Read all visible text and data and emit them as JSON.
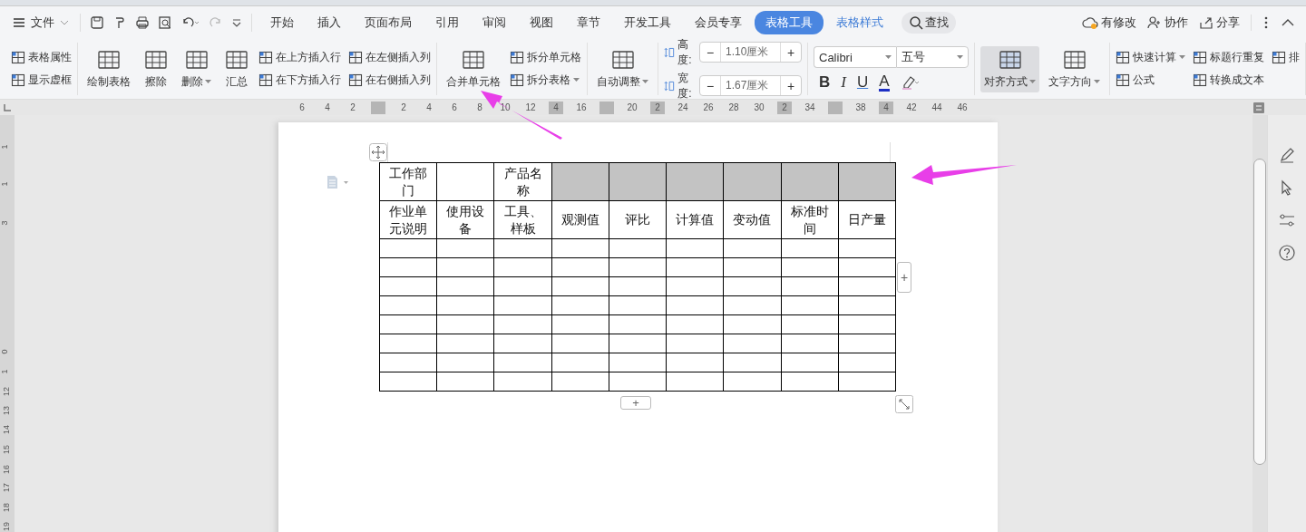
{
  "menu_bar": {
    "file_menu": "文件",
    "tabs": [
      {
        "label": "开始",
        "kind": "plain",
        "selected": false
      },
      {
        "label": "插入",
        "kind": "plain",
        "selected": false
      },
      {
        "label": "页面布局",
        "kind": "plain",
        "selected": false
      },
      {
        "label": "引用",
        "kind": "plain",
        "selected": false
      },
      {
        "label": "审阅",
        "kind": "plain",
        "selected": false
      },
      {
        "label": "视图",
        "kind": "plain",
        "selected": false
      },
      {
        "label": "章节",
        "kind": "plain",
        "selected": false
      },
      {
        "label": "开发工具",
        "kind": "plain",
        "selected": false
      },
      {
        "label": "会员专享",
        "kind": "plain",
        "selected": false
      },
      {
        "label": "表格工具",
        "kind": "context",
        "selected": true
      },
      {
        "label": "表格样式",
        "kind": "context",
        "selected": false
      }
    ],
    "search": "查找",
    "actions": [
      "有修改",
      "协作",
      "分享"
    ]
  },
  "ribbon": [
    {
      "items": [
        {
          "kind": "small",
          "label": "表格属性",
          "dropdown": false
        },
        {
          "kind": "small",
          "label": "显示虚框",
          "dropdown": false
        }
      ]
    },
    {
      "items": [
        {
          "kind": "large",
          "label": "绘制表格",
          "dropdown": false
        },
        {
          "kind": "large",
          "label": "擦除",
          "dropdown": false
        },
        {
          "kind": "large",
          "label": "删除",
          "dropdown": true
        },
        {
          "kind": "large",
          "label": "汇总",
          "dropdown": false
        },
        {
          "kind": "small",
          "label": "在上方插入行",
          "dropdown": false
        },
        {
          "kind": "small",
          "label": "在下方插入行",
          "dropdown": false
        },
        {
          "kind": "small",
          "label": "在左侧插入列",
          "dropdown": false
        },
        {
          "kind": "small",
          "label": "在右侧插入列",
          "dropdown": false
        }
      ]
    },
    {
      "items": [
        {
          "kind": "large",
          "label": "合并单元格",
          "dropdown": false
        },
        {
          "kind": "small",
          "label": "拆分单元格",
          "dropdown": false
        },
        {
          "kind": "small",
          "label": "拆分表格",
          "dropdown": true
        }
      ]
    },
    {
      "items": [
        {
          "kind": "large",
          "label": "自动调整",
          "dropdown": true
        }
      ]
    },
    {
      "items": [
        {
          "kind": "stepper",
          "label": "高度:",
          "value": "1.10厘米",
          "minus": "−",
          "plus": "+"
        },
        {
          "kind": "stepper",
          "label": "宽度:",
          "value": "1.67厘米",
          "minus": "−",
          "plus": "+"
        }
      ]
    },
    {
      "items": [
        {
          "kind": "font",
          "font": "Calibri",
          "size": "五号",
          "bold": "B",
          "italic": "I",
          "underline": "U",
          "font_color_letter": "A"
        }
      ]
    },
    {
      "items": [
        {
          "kind": "large",
          "label": "对齐方式",
          "dropdown": true,
          "selected": true
        },
        {
          "kind": "large",
          "label": "文字方向",
          "dropdown": true,
          "selected": false
        }
      ]
    },
    {
      "items": [
        {
          "kind": "small",
          "label": "快速计算",
          "dropdown": true
        },
        {
          "kind": "small",
          "label": "公式",
          "dropdown": false
        },
        {
          "kind": "small",
          "label": "标题行重复",
          "dropdown": false
        },
        {
          "kind": "small",
          "label": "转换成文本",
          "dropdown": false
        },
        {
          "kind": "small",
          "label": "排",
          "dropdown": false
        }
      ]
    }
  ],
  "ruler": [
    {
      "label": "6",
      "marker": false
    },
    {
      "label": "4",
      "marker": false
    },
    {
      "label": "2",
      "marker": false
    },
    {
      "marker": true
    },
    {
      "label": "2",
      "marker": false
    },
    {
      "label": "4",
      "marker": false
    },
    {
      "label": "6",
      "marker": false
    },
    {
      "label": "8",
      "marker": false
    },
    {
      "label": "10",
      "marker": false
    },
    {
      "label": "12",
      "marker": false
    },
    {
      "label": "4",
      "marker": true
    },
    {
      "label": "16",
      "marker": false
    },
    {
      "marker": true
    },
    {
      "label": "20",
      "marker": false
    },
    {
      "label": "2",
      "marker": true
    },
    {
      "label": "24",
      "marker": false
    },
    {
      "label": "26",
      "marker": false
    },
    {
      "label": "28",
      "marker": false
    },
    {
      "label": "30",
      "marker": false
    },
    {
      "label": "2",
      "marker": true
    },
    {
      "label": "34",
      "marker": false
    },
    {
      "marker": true
    },
    {
      "label": "38",
      "marker": false
    },
    {
      "label": "4",
      "marker": true
    },
    {
      "label": "42",
      "marker": false
    },
    {
      "label": "44",
      "marker": false
    },
    {
      "label": "46",
      "marker": false
    }
  ],
  "left_ruler": [
    "1",
    "1",
    "3",
    "0",
    "1",
    "12",
    "13",
    "14",
    "15",
    "16",
    "17",
    "18",
    "19"
  ],
  "table": {
    "rows": [
      [
        {
          "text": "工作部门",
          "shaded": false
        },
        {
          "shaded": false
        },
        {
          "text": "产品名称",
          "shaded": false
        },
        {
          "shaded": true
        },
        {
          "shaded": true
        },
        {
          "shaded": true
        },
        {
          "shaded": true
        },
        {
          "shaded": true
        },
        {
          "shaded": true
        }
      ],
      [
        {
          "text": "作业单元说明",
          "shaded": false
        },
        {
          "text": "使用设备",
          "shaded": false
        },
        {
          "text": "工具、样板",
          "shaded": false
        },
        {
          "text": "观测值",
          "shaded": false
        },
        {
          "text": "评比",
          "shaded": false
        },
        {
          "text": "计算值",
          "shaded": false
        },
        {
          "text": "变动值",
          "shaded": false
        },
        {
          "text": "标准时间",
          "shaded": false
        },
        {
          "text": "日产量",
          "shaded": false
        }
      ],
      [
        {
          "shaded": false
        },
        {
          "shaded": false
        },
        {
          "shaded": false
        },
        {
          "shaded": false
        },
        {
          "shaded": false
        },
        {
          "shaded": false
        },
        {
          "shaded": false
        },
        {
          "shaded": false
        },
        {
          "shaded": false
        }
      ],
      [
        {
          "shaded": false
        },
        {
          "shaded": false
        },
        {
          "shaded": false
        },
        {
          "shaded": false
        },
        {
          "shaded": false
        },
        {
          "shaded": false
        },
        {
          "shaded": false
        },
        {
          "shaded": false
        },
        {
          "shaded": false
        }
      ],
      [
        {
          "shaded": false
        },
        {
          "shaded": false
        },
        {
          "shaded": false
        },
        {
          "shaded": false
        },
        {
          "shaded": false
        },
        {
          "shaded": false
        },
        {
          "shaded": false
        },
        {
          "shaded": false
        },
        {
          "shaded": false
        }
      ],
      [
        {
          "shaded": false
        },
        {
          "shaded": false
        },
        {
          "shaded": false
        },
        {
          "shaded": false
        },
        {
          "shaded": false
        },
        {
          "shaded": false
        },
        {
          "shaded": false
        },
        {
          "shaded": false
        },
        {
          "shaded": false
        }
      ],
      [
        {
          "shaded": false
        },
        {
          "shaded": false
        },
        {
          "shaded": false
        },
        {
          "shaded": false
        },
        {
          "shaded": false
        },
        {
          "shaded": false
        },
        {
          "shaded": false
        },
        {
          "shaded": false
        },
        {
          "shaded": false
        }
      ],
      [
        {
          "shaded": false
        },
        {
          "shaded": false
        },
        {
          "shaded": false
        },
        {
          "shaded": false
        },
        {
          "shaded": false
        },
        {
          "shaded": false
        },
        {
          "shaded": false
        },
        {
          "shaded": false
        },
        {
          "shaded": false
        }
      ],
      [
        {
          "shaded": false
        },
        {
          "shaded": false
        },
        {
          "shaded": false
        },
        {
          "shaded": false
        },
        {
          "shaded": false
        },
        {
          "shaded": false
        },
        {
          "shaded": false
        },
        {
          "shaded": false
        },
        {
          "shaded": false
        }
      ],
      [
        {
          "shaded": false
        },
        {
          "shaded": false
        },
        {
          "shaded": false
        },
        {
          "shaded": false
        },
        {
          "shaded": false
        },
        {
          "shaded": false
        },
        {
          "shaded": false
        },
        {
          "shaded": false
        },
        {
          "shaded": false
        }
      ]
    ],
    "add_row": "+",
    "add_column": "+"
  }
}
